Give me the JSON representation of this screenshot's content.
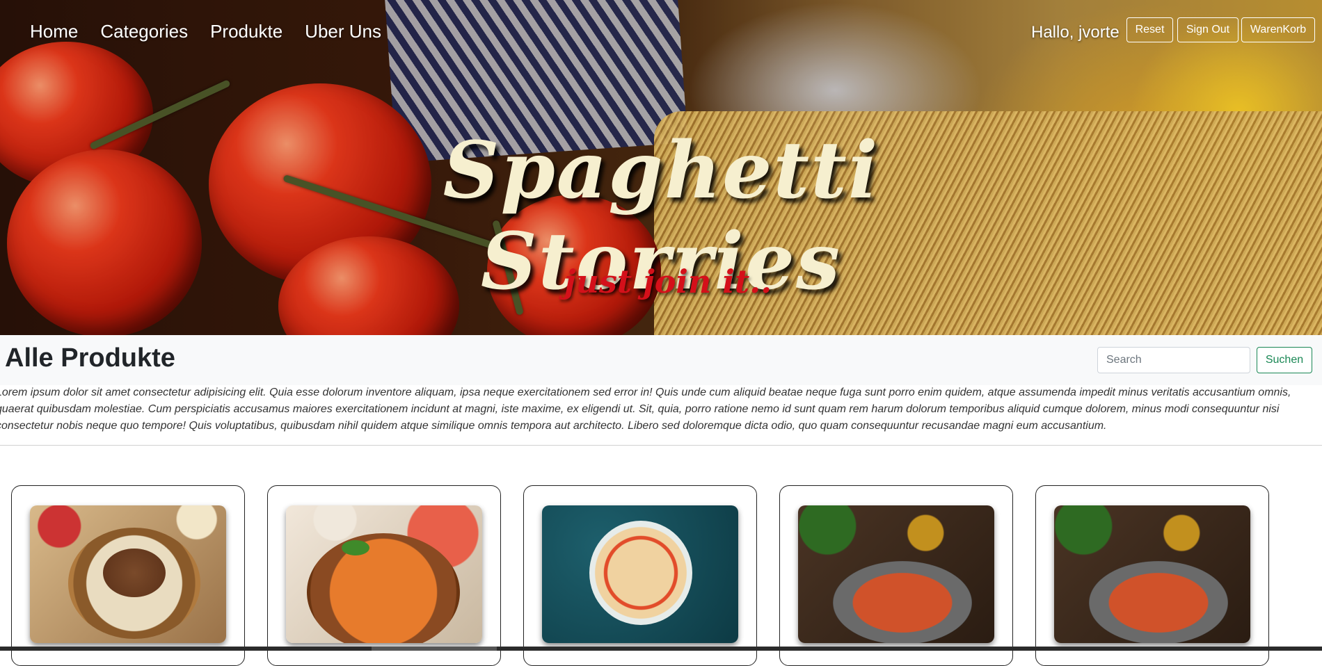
{
  "nav": {
    "items": [
      {
        "label": "Home"
      },
      {
        "label": "Categories"
      },
      {
        "label": "Produkte"
      },
      {
        "label": "Uber Uns"
      }
    ]
  },
  "user": {
    "greeting": "Hallo, jvorte",
    "reset_label": "Reset",
    "signout_label": "Sign Out",
    "cart_label": "WarenKorb"
  },
  "hero": {
    "title": "Spaghetti Storries",
    "subtitle": "just join it.."
  },
  "toolbar": {
    "title": "Alle Produkte",
    "search_placeholder": "Search",
    "search_button": "Suchen"
  },
  "intro_text": "Lorem ipsum dolor sit amet consectetur adipisicing elit. Quia esse dolorum inventore aliquam, ipsa neque exercitationem sed error in! Quis unde cum aliquid beatae neque fuga sunt porro enim quidem, atque assumenda impedit minus veritatis accusantium omnis, quaerat quibusdam molestiae. Cum perspiciatis accusamus maiores exercitationem incidunt at magni, iste maxime, ex eligendi ut. Sit, quia, porro ratione nemo id sunt quam rem harum dolorum temporibus aliquid cumque dolorem, minus modi consequuntur nisi consectetur nobis neque quo tempore! Quis voluptatibus, quibusdam nihil quidem atque similique omnis tempora aut architecto. Libero sed doloremque dicta odio, quo quam consequuntur recusandae magni eum accusantium.",
  "colors": {
    "accent_green": "#198754",
    "hero_title": "#f6efcf",
    "hero_subtitle": "#d4101a",
    "toolbar_bg": "#f8f9fa"
  }
}
